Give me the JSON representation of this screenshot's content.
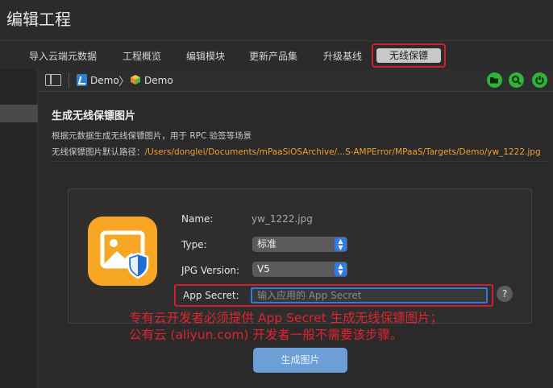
{
  "app_title": "编辑工程",
  "tabs": [
    {
      "label": "导入云端元数据"
    },
    {
      "label": "工程概览"
    },
    {
      "label": "编辑模块"
    },
    {
      "label": "更新产品集"
    },
    {
      "label": "升级基线"
    },
    {
      "label": "无线保镖",
      "active": true
    }
  ],
  "breadcrumb": {
    "project": "Demo",
    "target": "Demo"
  },
  "toolbar_icons": [
    "folder-open-icon",
    "search-icon",
    "power-icon"
  ],
  "section": {
    "title": "生成无线保镖图片",
    "description": "根据元数据生成无线保镖图片，用于 RPC 验签等场景",
    "path_label": "无线保镖图片默认路径：",
    "path_value": "/Users/donglei/Documents/mPaaSiOSArchive/...S-AMPError/MPaaS/Targets/Demo/yw_1222.jpg"
  },
  "form": {
    "name_label": "Name:",
    "name_value": "yw_1222.jpg",
    "type_label": "Type:",
    "type_value": "标准",
    "jpg_label": "JPG Version:",
    "jpg_value": "V5",
    "secret_label": "App Secret:",
    "secret_placeholder": "输入应用的 App Secret",
    "help": "?"
  },
  "annotation": {
    "line1": "专有云开发者必须提供 App Secret 生成无线保镖图片；",
    "line2": "公有云 (aliyun.com) 开发者一般不需要该步骤。"
  },
  "generate_button": "生成图片",
  "colors": {
    "accent_blue": "#2f7ae5",
    "path_orange": "#f0a030",
    "highlight_red": "#d41f2b",
    "toolbar_green": "#2fb43a",
    "icon_orange": "#f6a623"
  }
}
